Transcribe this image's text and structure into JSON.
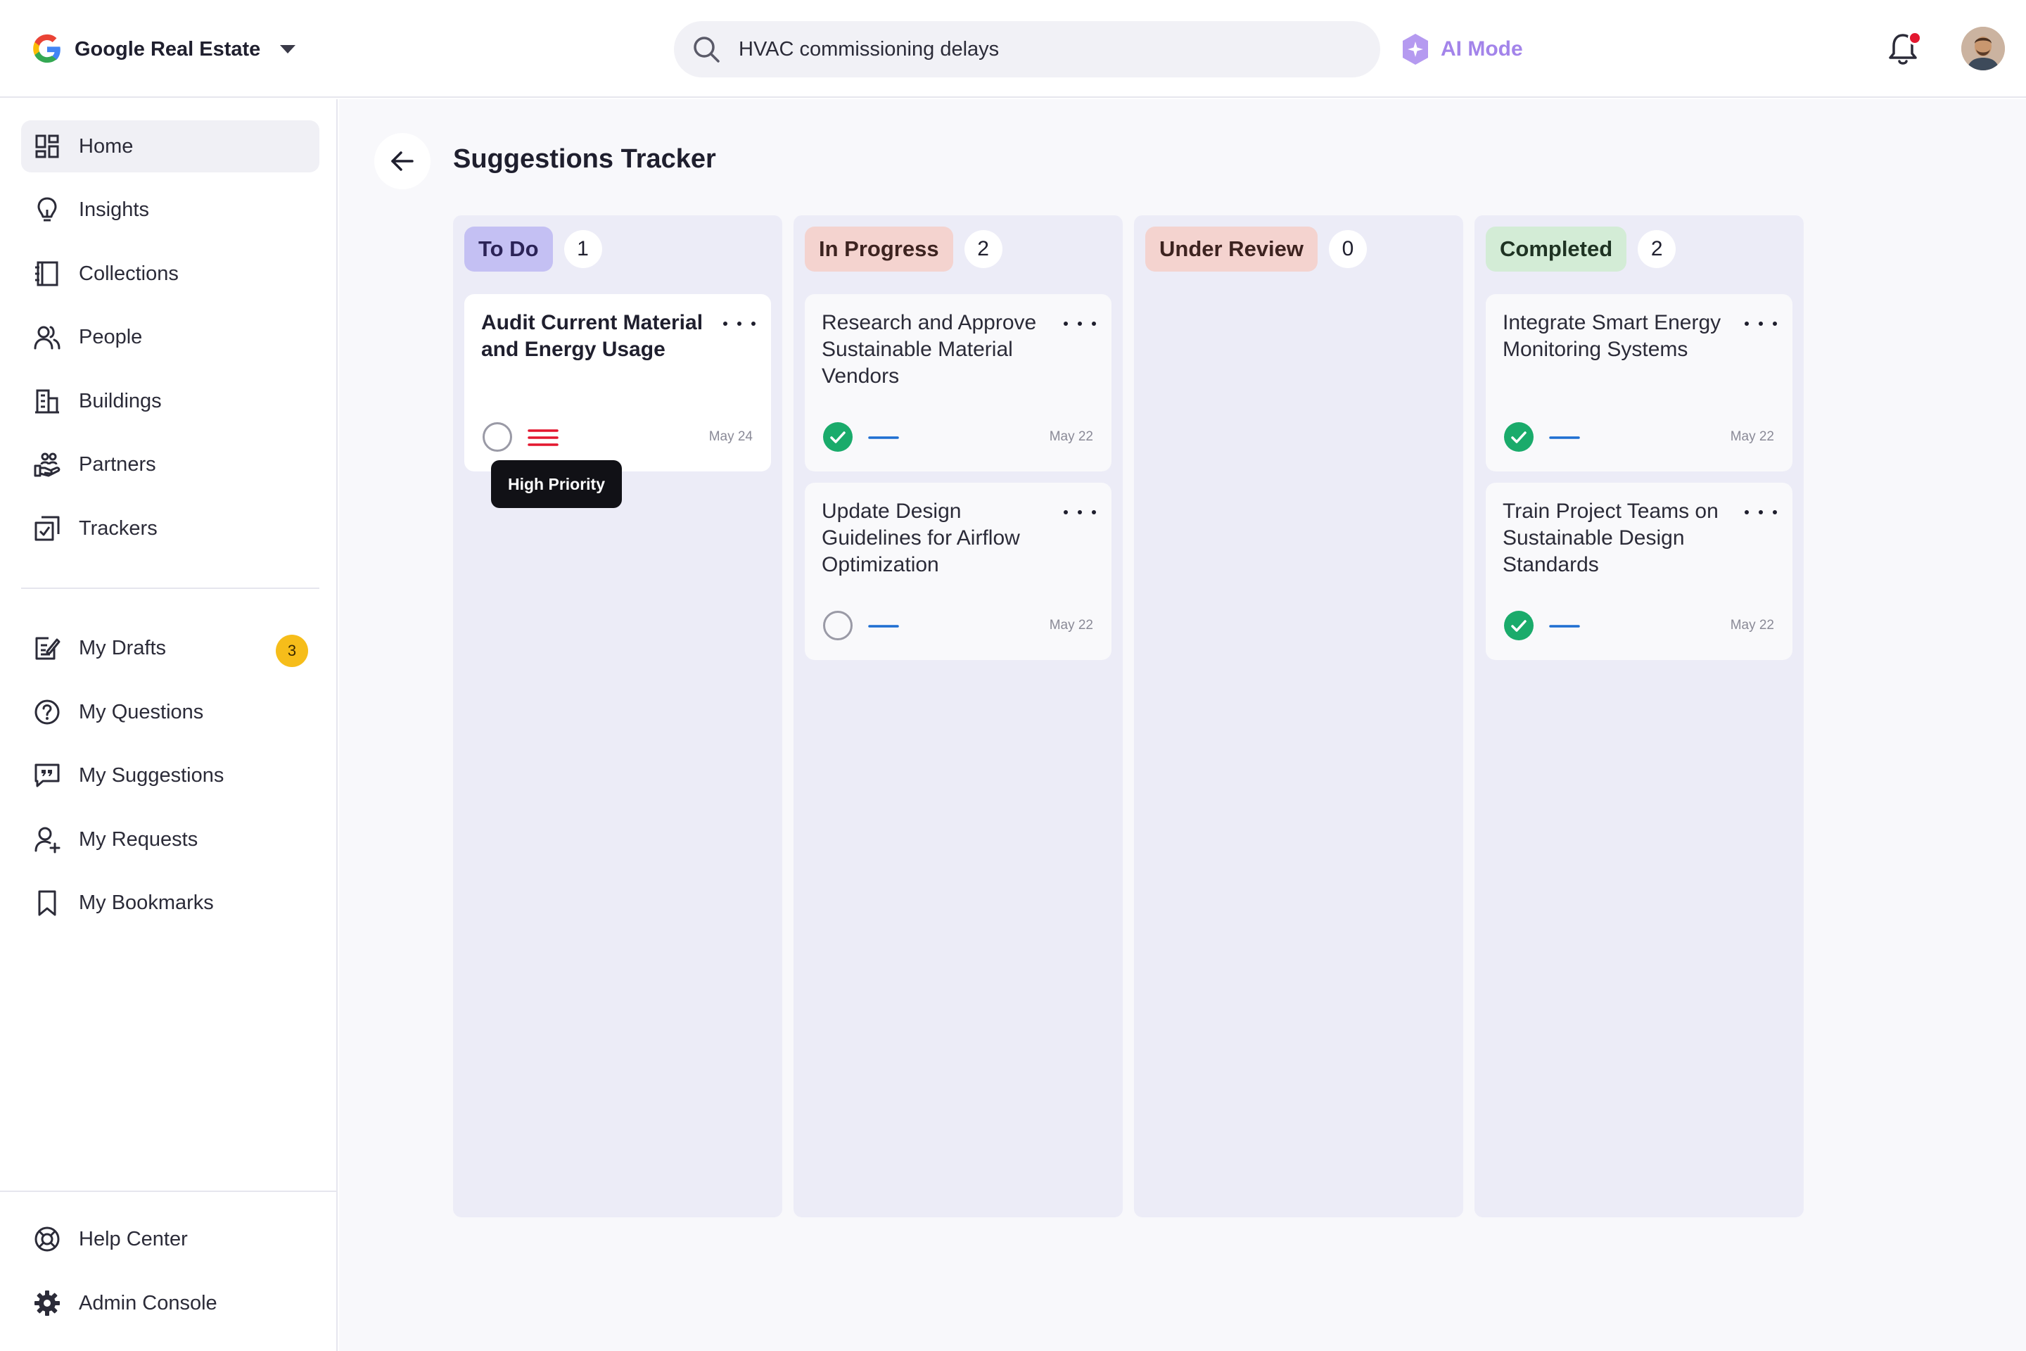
{
  "header": {
    "brand_name": "Google Real Estate",
    "search": {
      "value": "HVAC commissioning delays",
      "placeholder": "Search"
    },
    "ai_mode_label": "AI Mode",
    "notification_dot": true
  },
  "sidebar": {
    "primary": [
      {
        "label": "Home",
        "icon": "home-grid-icon",
        "active": true
      },
      {
        "label": "Insights",
        "icon": "lightbulb-icon"
      },
      {
        "label": "Collections",
        "icon": "notebook-icon"
      },
      {
        "label": "People",
        "icon": "people-icon"
      },
      {
        "label": "Buildings",
        "icon": "building-icon"
      },
      {
        "label": "Partners",
        "icon": "handshake-icon"
      },
      {
        "label": "Trackers",
        "icon": "checkbox-icon"
      }
    ],
    "secondary": [
      {
        "label": "My Drafts",
        "icon": "drafts-icon",
        "badge": "3"
      },
      {
        "label": "My Questions",
        "icon": "question-icon"
      },
      {
        "label": "My Suggestions",
        "icon": "suggestion-icon"
      },
      {
        "label": "My Requests",
        "icon": "person-add-icon"
      },
      {
        "label": "My Bookmarks",
        "icon": "bookmark-icon"
      }
    ],
    "footer": [
      {
        "label": "Help Center",
        "icon": "lifebuoy-icon"
      },
      {
        "label": "Admin Console",
        "icon": "gear-icon"
      }
    ]
  },
  "main": {
    "title": "Suggestions Tracker",
    "columns": [
      {
        "label": "To Do",
        "count": "1",
        "pill_bg": "#c4c0f3",
        "pill_fg": "#2b2357",
        "cards": [
          {
            "title": "Audit Current Material and Energy Usage",
            "date": "May 24",
            "status": "open",
            "priority": "high"
          }
        ]
      },
      {
        "label": "In Progress",
        "count": "2",
        "pill_bg": "#f4d3cf",
        "pill_fg": "#3d2320",
        "cards": [
          {
            "title": "Research and Approve Sustainable Material Vendors",
            "date": "May 22",
            "status": "done",
            "priority": "medium"
          },
          {
            "title": "Update Design Guidelines for Airflow Optimization",
            "date": "May 22",
            "status": "open",
            "priority": "medium"
          }
        ]
      },
      {
        "label": "Under Review",
        "count": "0",
        "pill_bg": "#f4d3cf",
        "pill_fg": "#3d2320",
        "cards": []
      },
      {
        "label": "Completed",
        "count": "2",
        "pill_bg": "#d3ecd6",
        "pill_fg": "#1f3323",
        "cards": [
          {
            "title": "Integrate Smart Energy Monitoring Systems",
            "date": "May 22",
            "status": "done",
            "priority": "medium"
          },
          {
            "title": "Train Project Teams on Sustainable Design Standards",
            "date": "May 22",
            "status": "done",
            "priority": "medium"
          }
        ]
      }
    ],
    "tooltip": "High Priority"
  },
  "colors": {
    "accent_ai": "#a384ea",
    "done_green": "#1aab6b",
    "priority_high": "#e3172f",
    "priority_medium": "#1f6fd1",
    "badge_yellow": "#f6bd1a"
  }
}
